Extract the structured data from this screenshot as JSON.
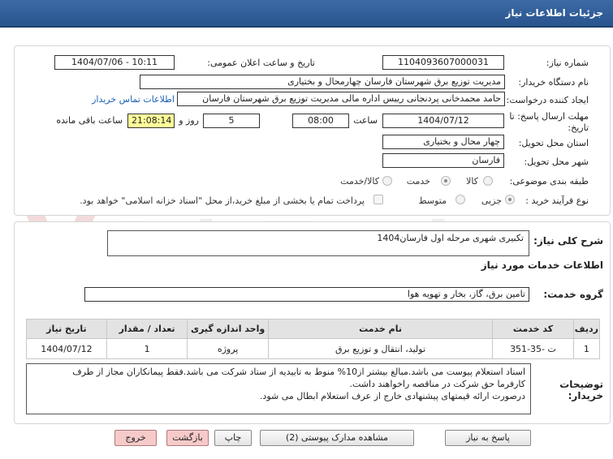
{
  "header": {
    "title": "جزئیات اطلاعات نیاز"
  },
  "form": {
    "need_number_label": "شماره نیاز:",
    "need_number": "1104093607000031",
    "announce_label": "تاریخ و ساعت اعلان عمومی:",
    "announce_value": "1404/07/06 - 10:11",
    "buyer_org_label": "نام دستگاه خریدار:",
    "buyer_org": "مدیریت توزیع برق شهرستان فارسان چهارمحال و بختیاری",
    "requester_label": "ایجاد کننده درخواست:",
    "requester": "حامد محمدخانی پردنجانی رییس اداره مالی مدیریت توزیع برق شهرستان فارسان",
    "contact_link": "اطلاعات تماس خریدار",
    "deadline_label_1": "مهلت ارسال پاسخ: تا",
    "deadline_label_2": "تاریخ:",
    "deadline_date": "1404/07/12",
    "time_label": "ساعت",
    "deadline_time": "08:00",
    "days_value": "5",
    "days_label": "روز و",
    "remaining_time": "21:08:14",
    "remaining_label": "ساعت باقی مانده",
    "province_label": "استان محل تحویل:",
    "province": "چهار محال و بختیاری",
    "city_label": "شهر محل تحویل:",
    "city": "فارسان",
    "category_label": "طبقه بندی موضوعی:",
    "category_options": [
      "کالا",
      "خدمت",
      "کالا/خدمت"
    ],
    "category_selected": 1,
    "process_label": "نوع فرآیند خرید :",
    "process_options": [
      "جزیی",
      "متوسط"
    ],
    "process_selected": 0,
    "payment_note": "پرداخت تمام یا بخشی از مبلغ خرید،از محل \"اسناد خزانه اسلامی\" خواهد بود."
  },
  "details": {
    "summary_label": "شرح کلی نیاز:",
    "summary": "تکبیری شهری مرحله اول فارسان1404",
    "services_title": "اطلاعات خدمات مورد نیاز",
    "service_group_label": "گروه خدمت:",
    "service_group": "تامین برق، گاز، بخار و تهویه هوا",
    "table": {
      "headers": [
        "ردیف",
        "کد خدمت",
        "نام خدمت",
        "واحد اندازه گیری",
        "تعداد / مقدار",
        "تاریخ نیاز"
      ],
      "rows": [
        [
          "1",
          "ت -35-351",
          "تولید، انتقال و توزیع برق",
          "پروژه",
          "1",
          "1404/07/12"
        ]
      ]
    },
    "buyer_notes_label_1": "توضیحات",
    "buyer_notes_label_2": "خریدار:",
    "buyer_notes": [
      "اسناد استعلام پیوست می باشد.مبالغ بیشتر از10% منوط به تاییدیه از ستاد شرکت می باشد.فقط پیمانکاران مجاز از طرف",
      "کارفرما حق شرکت در مناقصه راخواهند داشت.",
      "درصورت ارائه قیمتهای پیشنهادی خارج از عرف استعلام ابطال می شود."
    ]
  },
  "buttons": {
    "reply": "پاسخ به نیاز",
    "attachments": "مشاهده مدارک پیوستی (2)",
    "print": "چاپ",
    "back": "بازگشت",
    "exit": "خروج"
  },
  "watermark": {
    "text": "AriaTender.net"
  },
  "colors": {
    "header": "#2f5d99",
    "highlight": "#ffff9a",
    "link": "#1a5fb4",
    "danger_button": "#f7caca"
  }
}
